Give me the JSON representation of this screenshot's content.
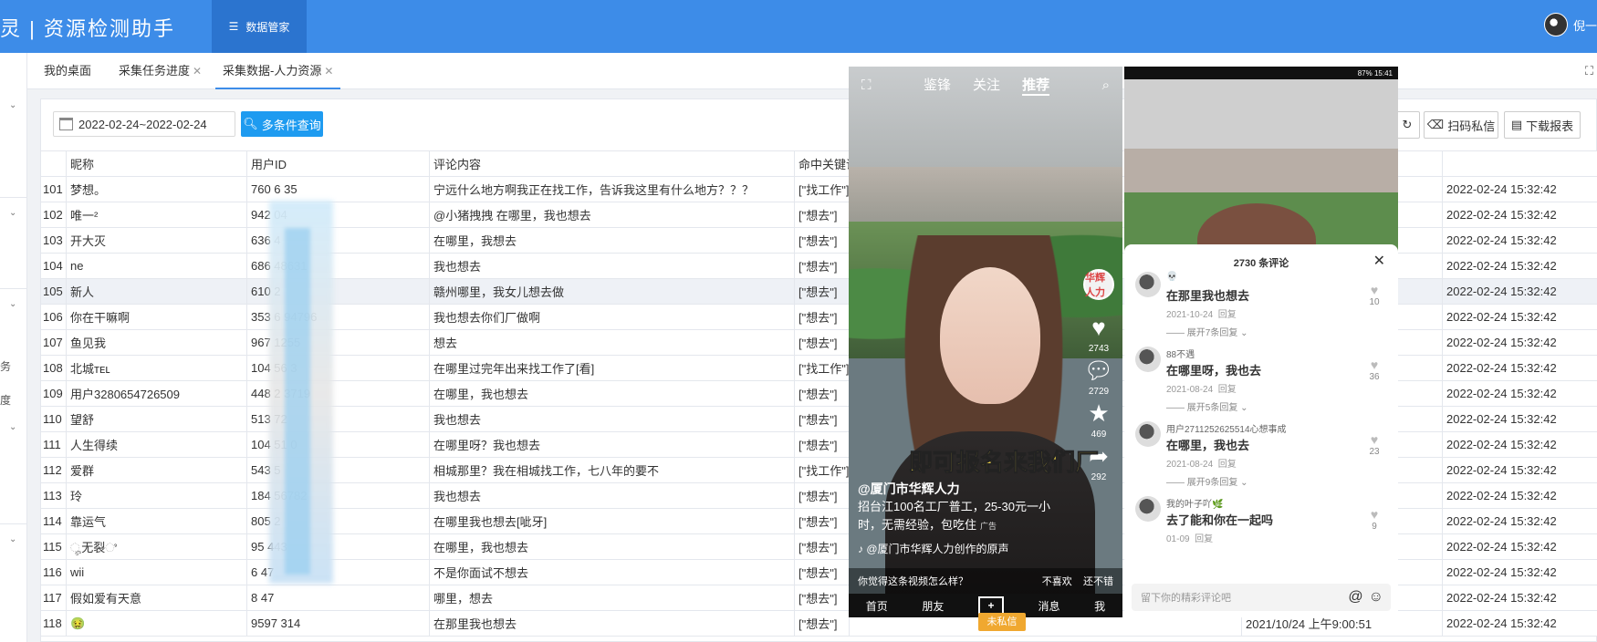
{
  "header": {
    "logo": "灵 | 资源检测助手",
    "nav_label": "数据管家",
    "user_name": "倪一"
  },
  "left_rail": {
    "texts": [
      "务",
      "度"
    ]
  },
  "tabs": [
    {
      "label": "我的桌面",
      "closable": false
    },
    {
      "label": "采集任务进度",
      "closable": true
    },
    {
      "label": "采集数据-人力资源",
      "closable": true,
      "active": true
    }
  ],
  "filters": {
    "date_range": "2022-02-24~2022-02-24",
    "query_button": "多条件查询"
  },
  "actions": {
    "refresh_label": "",
    "scan_label": "扫码私信",
    "download_label": "下载报表"
  },
  "table": {
    "columns": [
      "",
      "昵称",
      "用户ID",
      "评论内容",
      "命中关键词"
    ],
    "time_value": "2022-02-24 15:32:42",
    "rows": [
      {
        "no": "101",
        "nick": "梦想。",
        "uid": "760      6   35",
        "comment": "宁远什么地方啊我正在找工作，告诉我这里有什么地方？？？",
        "kw": "[\"找工作\"]"
      },
      {
        "no": "102",
        "nick": "唯一²",
        "uid": "942      04",
        "comment": "@小猪拽拽 在哪里，我也想去",
        "kw": "[\"想去\"]"
      },
      {
        "no": "103",
        "nick": "开大灭",
        "uid": "636      4",
        "comment": "在哪里，我想去",
        "kw": "[\"想去\"]"
      },
      {
        "no": "104",
        "nick": "ne",
        "uid": "686       48631",
        "comment": "我也想去",
        "kw": "[\"想去\"]"
      },
      {
        "no": "105",
        "nick": "新人",
        "uid": "610      2",
        "comment": "赣州哪里，我女儿想去做",
        "kw": "[\"想去\"]"
      },
      {
        "no": "106",
        "nick": "你在干嘛啊",
        "uid": "353      6   94796",
        "comment": "我也想去你们厂做啊",
        "kw": "[\"想去\"]"
      },
      {
        "no": "107",
        "nick": "鱼见我",
        "uid": "967      1255",
        "comment": "想去",
        "kw": "[\"想去\"]"
      },
      {
        "no": "108",
        "nick": "北城ᴛᴇʟ",
        "uid": "104      56   3",
        "comment": "在哪里过完年出来找工作了[看]",
        "kw": "[\"找工作\"]"
      },
      {
        "no": "109",
        "nick": "用户3280654726509",
        "uid": "448      2   3719",
        "comment": "在哪里，我也想去",
        "kw": "[\"想去\"]"
      },
      {
        "no": "110",
        "nick": "望舒",
        "uid": "513      72",
        "comment": "我也想去",
        "kw": "[\"想去\"]"
      },
      {
        "no": "111",
        "nick": "人生得续",
        "uid": "104      51   0",
        "comment": "在哪里呀？我也想去",
        "kw": "[\"想去\"]"
      },
      {
        "no": "112",
        "nick": "爱群",
        "uid": "543      5",
        "comment": "相城那里？我在相城找工作，七八年的要不",
        "kw": "[\"找工作\"]"
      },
      {
        "no": "113",
        "nick": "玲",
        "uid": "184      56782",
        "comment": "我也想去",
        "kw": "[\"想去\"]"
      },
      {
        "no": "114",
        "nick": "靠运气",
        "uid": "805      2",
        "comment": "在哪里我也想去[呲牙]",
        "kw": "[\"想去\"]"
      },
      {
        "no": "115",
        "nick": "ೄ无裂ಿ",
        "uid": "95      443",
        "comment": "在哪里，我也想去",
        "kw": "[\"想去\"]"
      },
      {
        "no": "116",
        "nick": "wii",
        "uid": "6      47",
        "comment": "不是你面试不想去",
        "kw": "[\"想去\"]"
      },
      {
        "no": "117",
        "nick": "假如爱有天意",
        "uid": "8      47",
        "comment": "哪里，想去",
        "kw": "[\"想去\"]"
      },
      {
        "no": "118",
        "nick": "🤢",
        "uid": "9597      314",
        "comment": "在那里我也想去",
        "kw": "[\"想去\"]"
      }
    ],
    "last_row_extra": {
      "a": "2021/10/24 上午9:00:51",
      "b": "2022-02-24 15:32:42",
      "badge": "未私信"
    }
  },
  "phone1": {
    "top_tabs": [
      "鉴锋",
      "关注",
      "推荐"
    ],
    "brand_badge": "华辉人力",
    "counts": {
      "likes": "2743",
      "comments": "2729",
      "stars": "469",
      "shares": "292"
    },
    "yellow_caption": "即可报名来我们厂",
    "account": "@厦门市华辉人力",
    "desc": "招台江100名工厂普工，25-30元一小时，无需经验，包吃住",
    "ad_tag": "广告",
    "music": "@厦门市华辉人力创作的原声",
    "question": "你觉得这条视频怎么样？",
    "dislike": "不喜欢",
    "ok": "还不错",
    "bottom_nav": [
      "首页",
      "朋友",
      "+",
      "消息",
      "我"
    ]
  },
  "phone2": {
    "status_left": "",
    "status_right": "87% 15:41",
    "sheet_title": "2730 条评论",
    "comments": [
      {
        "user": "💀",
        "text": "在那里我也想去",
        "date": "2021-10-24",
        "reply": "回复",
        "more": "展开7条回复",
        "likes": "10"
      },
      {
        "user": "88不遇",
        "text": "在哪里呀，我也去",
        "date": "2021-08-24",
        "reply": "回复",
        "more": "展开5条回复",
        "likes": "36"
      },
      {
        "user": "用户2711252625514心想事成",
        "text": "在哪里，我也去",
        "date": "2021-08-24",
        "reply": "回复",
        "more": "展开9条回复",
        "likes": "23"
      },
      {
        "user": "我的叶子吖🌿",
        "text": "去了能和你在一起吗",
        "date": "01-09",
        "reply": "回复",
        "more": "",
        "likes": "9"
      }
    ],
    "input_placeholder": "留下你的精彩评论吧"
  }
}
